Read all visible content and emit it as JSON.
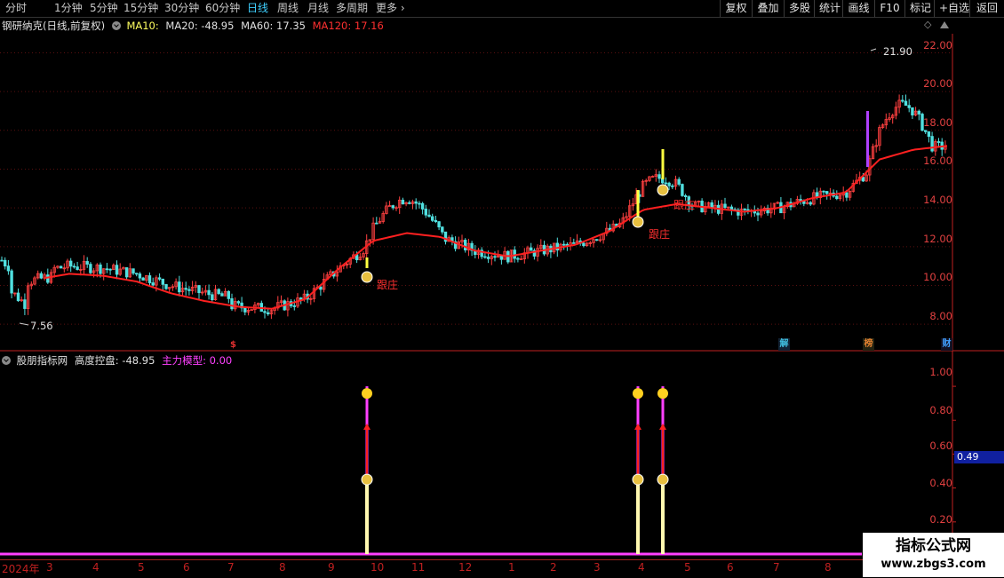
{
  "toolbar": {
    "periods": [
      "分时",
      "1分钟",
      "5分钟",
      "15分钟",
      "30分钟",
      "60分钟",
      "日线",
      "周线",
      "月线",
      "多周期",
      "更多"
    ],
    "active_period": "日线",
    "more_arrow": "›",
    "right_buttons": [
      "复权",
      "叠加",
      "多股",
      "统计",
      "画线",
      "F10",
      "标记",
      "+自选",
      "返回"
    ]
  },
  "main_info": {
    "stock": "钢研纳克(日线,前复权)",
    "ma10": "MA10:",
    "ma20": "MA20: -48.95",
    "ma60": "MA60: 17.35",
    "ma120": "MA120: 17.16",
    "diamond_icon": "◇"
  },
  "price_axis": [
    "22.00",
    "20.00",
    "18.00",
    "16.00",
    "14.00",
    "12.00",
    "10.00",
    "8.00"
  ],
  "annotations": {
    "high": "21.90",
    "low": "7.56",
    "follow_labels": [
      "跟庄",
      "跟庄",
      "跟庄"
    ],
    "event_tags": [
      {
        "text": "$",
        "color": "#e03030"
      },
      {
        "text": "解",
        "color": "#40c0e0"
      },
      {
        "text": "榜",
        "color": "#e08030"
      },
      {
        "text": "财",
        "color": "#40a0ff"
      }
    ]
  },
  "sub_info": {
    "name": "股朋指标网",
    "height": "高度控盘: -48.95",
    "model": "主力模型: 0.00"
  },
  "sub_axis": [
    "1.00",
    "0.80",
    "0.60",
    "0.40",
    "0.20"
  ],
  "sub_current": "0.49",
  "date_axis": [
    "2024年",
    "3",
    "4",
    "5",
    "6",
    "7",
    "8",
    "9",
    "10",
    "11",
    "12",
    "1",
    "2",
    "3",
    "4",
    "5",
    "6",
    "7",
    "8"
  ],
  "watermark": {
    "line1": "指标公式网",
    "line2": "www.zbgs3.com"
  },
  "colors": {
    "ma": "#ff2020",
    "up": "#ff4040",
    "down": "#50e0e0",
    "axis": "#c02020",
    "yellow": "#ffff40",
    "purple": "#b040ff",
    "magenta": "#ff40ff"
  },
  "chart_data": {
    "type": "line",
    "title": "",
    "price_ylim": [
      7,
      22.8
    ],
    "ma_series_name": "MA120",
    "ma_values": [
      9.9,
      10.3,
      10.6,
      10.5,
      10.2,
      9.6,
      9.2,
      8.9,
      8.8,
      9.3,
      10.9,
      12.3,
      12.7,
      12.5,
      11.8,
      11.5,
      11.8,
      12.1,
      12.8,
      13.9,
      14.2,
      14.0,
      13.8,
      14.0,
      14.5,
      14.8,
      16.5,
      17.0,
      17.2
    ],
    "signals_x": [
      413,
      718,
      746
    ],
    "signal_value": 1.0,
    "sub_ylim": [
      0,
      1.1
    ]
  }
}
